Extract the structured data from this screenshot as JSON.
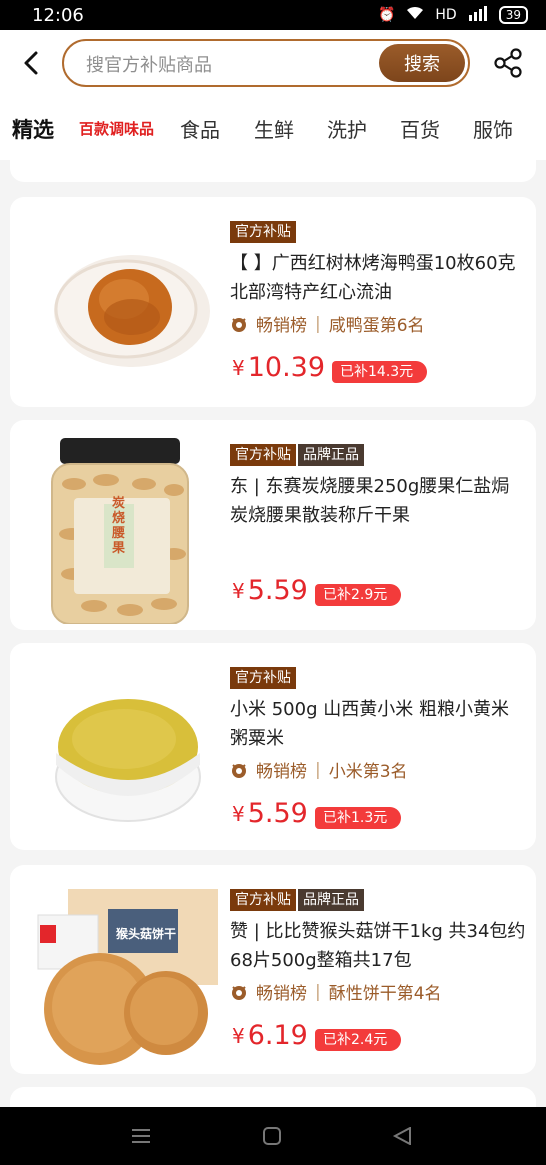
{
  "status": {
    "time": "12:06",
    "network": "HD",
    "battery": "39"
  },
  "search": {
    "placeholder": "搜官方补贴商品",
    "button": "搜索"
  },
  "tabs": [
    "精选",
    "百款调味品",
    "食品",
    "生鲜",
    "洗护",
    "百货",
    "服饰"
  ],
  "products": [
    {
      "tags": [
        "官方补贴"
      ],
      "title": "【 】广西红树林烤海鸭蛋10枚60克北部湾特产红心流油",
      "rank_label": "畅销榜",
      "rank_detail": "咸鸭蛋第6名",
      "currency": "¥",
      "price": "10.39",
      "subsidy": "已补14.3元"
    },
    {
      "tags": [
        "官方补贴",
        "品牌正品"
      ],
      "title": "东 | 东赛炭烧腰果250g腰果仁盐焗炭烧腰果散装称斤干果",
      "rank_label": "",
      "rank_detail": "",
      "currency": "¥",
      "price": "5.59",
      "subsidy": "已补2.9元"
    },
    {
      "tags": [
        "官方补贴"
      ],
      "title": "小米 500g 山西黄小米 粗粮小黄米粥粟米",
      "rank_label": "畅销榜",
      "rank_detail": "小米第3名",
      "currency": "¥",
      "price": "5.59",
      "subsidy": "已补1.3元"
    },
    {
      "tags": [
        "官方补贴",
        "品牌正品"
      ],
      "title": "赞 | 比比赞猴头菇饼干1kg 共34包约68片500g整箱共17包",
      "rank_label": "畅销榜",
      "rank_detail": "酥性饼干第4名",
      "currency": "¥",
      "price": "6.19",
      "subsidy": "已补2.4元"
    }
  ],
  "product_images": {
    "p0": {
      "package_label": ""
    },
    "p1": {
      "package_label": "炭烧腰果"
    },
    "p3": {
      "package_label": "猴头菇饼干"
    }
  }
}
